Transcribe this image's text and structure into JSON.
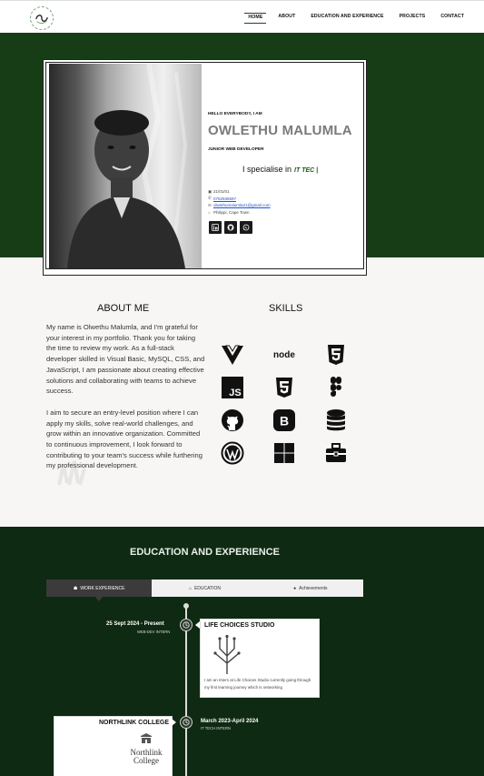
{
  "nav": {
    "items": [
      {
        "label": "HOME",
        "active": true
      },
      {
        "label": "ABOUT",
        "active": false
      },
      {
        "label": "EDUCATION AND EXPERIENCE",
        "active": false
      },
      {
        "label": "PROJECTS",
        "active": false
      },
      {
        "label": "CONTACT",
        "active": false
      }
    ],
    "logo_icon": "swirl-logo-icon"
  },
  "hero": {
    "greeting": "HELLO EVERYBODY, I AM",
    "name": "OWLETHU MALUMLA",
    "role": "JUNIOR WEB DEVELOPER",
    "specialise_prefix": "I specialise in",
    "specialise_typed": "IT TEC |",
    "contacts": {
      "birthday": "21/01/01",
      "phone": "0762936597",
      "email": "olwethumalumla21@gmail.com",
      "location": "Philippi, Cape Town"
    },
    "socials": [
      "linkedin-icon",
      "github-icon",
      "whatsapp-icon"
    ]
  },
  "about": {
    "title": "ABOUT ME",
    "paragraph1": " My name is Olwethu Malumla, and I'm grateful for your interest in my portfolio. Thank you for taking the time to review my work. As a full-stack developer skilled in Visual Basic, MySQL, CSS, and JavaScript, I am passionate about creating effective solutions and collaborating with teams to achieve success.",
    "paragraph2": "I aim to secure an entry-level position where I can apply my skills, solve real-world challenges, and grow within an innovative organization. Committed to continuous improvement, I look forward to contributing to your team's success while furthering my professional development."
  },
  "skills": {
    "title": "SKILLS",
    "icons": [
      "vue-icon",
      "node-icon",
      "html5-icon",
      "javascript-icon",
      "css3-icon",
      "figma-icon",
      "github-icon",
      "bootstrap-icon",
      "database-icon",
      "wordpress-icon",
      "windows-icon",
      "toolbox-icon"
    ],
    "node_text": "node",
    "js_text": "JS",
    "b_text": "B"
  },
  "education": {
    "title": "EDUCATION AND EXPERIENCE",
    "tabs": [
      {
        "label": "WORK EXPERIENCE",
        "icon": "user-icon",
        "active": true
      },
      {
        "label": "EDUCATION",
        "icon": "house-icon",
        "active": false
      },
      {
        "label": "Achievements",
        "icon": "circle-icon",
        "active": false
      }
    ],
    "entries": [
      {
        "date": "25 Sept 2024 - Present",
        "subtitle": "WEB-DEV INTERN",
        "card_title": "LIFE CHOICES STUDIO",
        "card_text": "I am an Intern at Life Choices Studio currently going through my first learning journey which is networking"
      },
      {
        "date": "March 2023-April 2024",
        "subtitle": "IT TECH INTERN",
        "card_title": "NORTHLINK COLLEGE",
        "logo_line1": "Northlink",
        "logo_line2": "College"
      }
    ]
  },
  "colors": {
    "hero_green": "#173d17",
    "edu_green": "#0f2a12",
    "accent_green": "#1a5a1a",
    "link_blue": "#2255cc"
  }
}
